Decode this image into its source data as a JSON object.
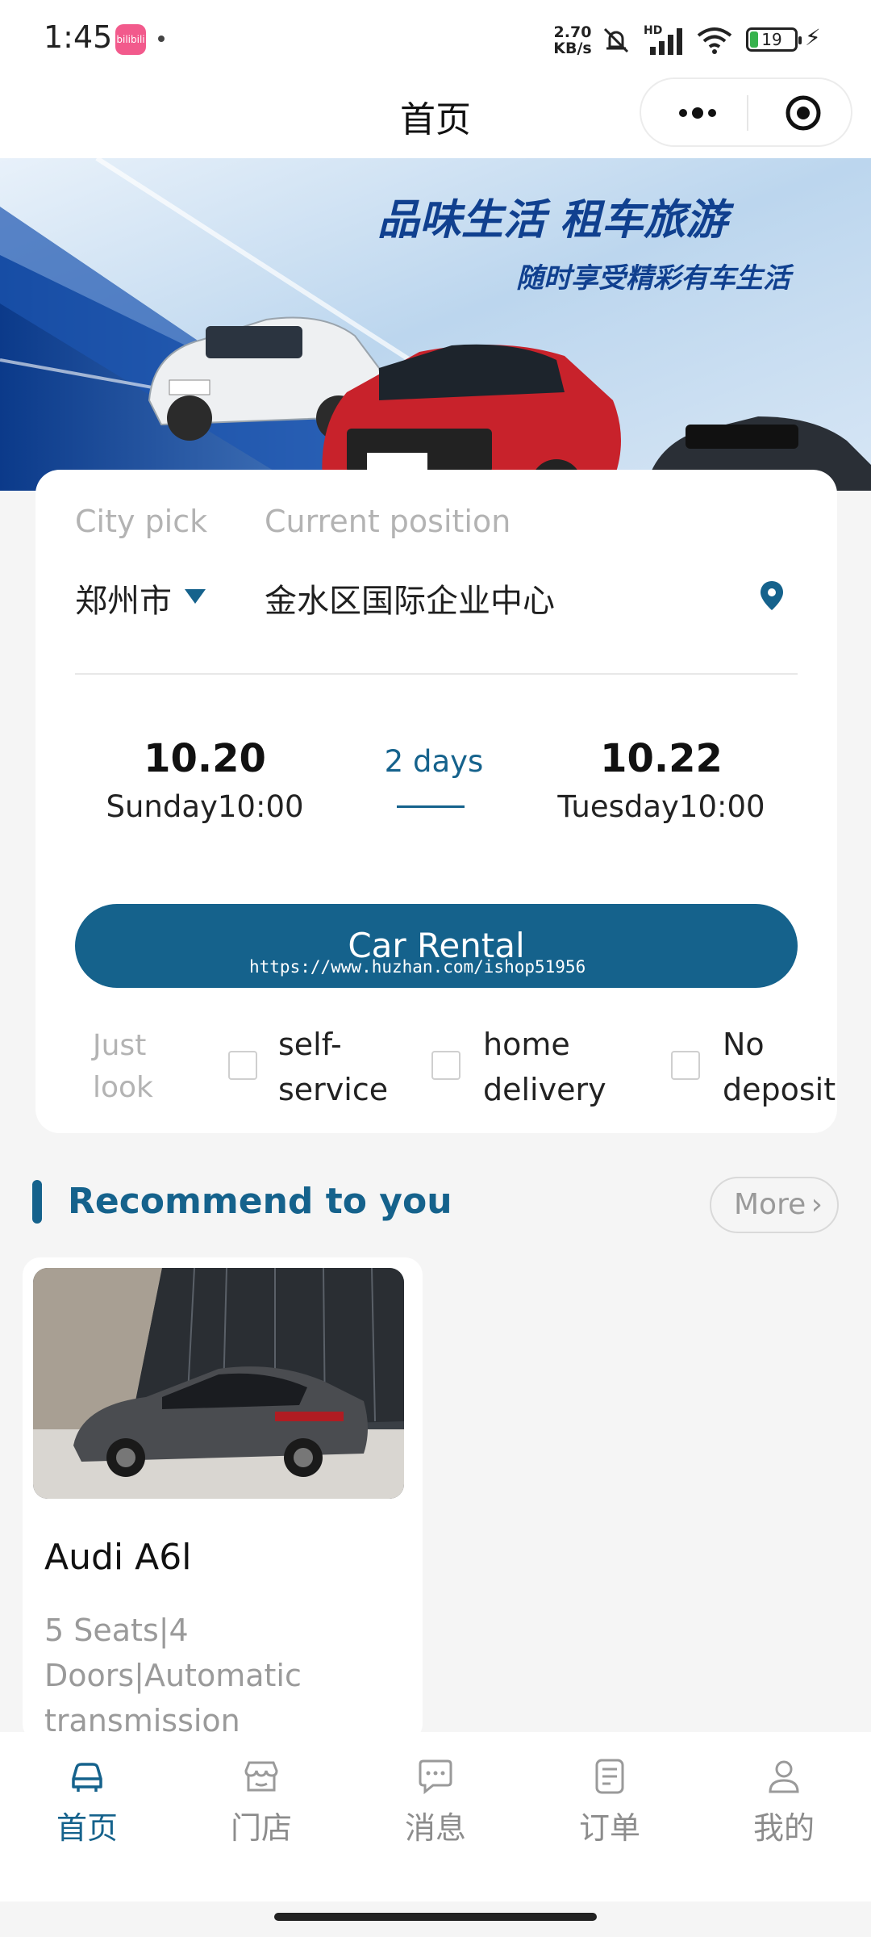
{
  "status_bar": {
    "time": "1:45",
    "app_badge": "bilibili",
    "net_speed_top": "2.70",
    "net_speed_bottom": "KB/s",
    "signal_label": "HD",
    "battery": "19"
  },
  "navbar": {
    "title": "首页"
  },
  "banner": {
    "headline": "品味生活 租车旅游",
    "tagline": "随时享受精彩有车生活"
  },
  "booking": {
    "city_label": "City pick",
    "position_label": "Current position",
    "city_value": "郑州市",
    "position_value": "金水区国际企业中心",
    "start_date": "10.20",
    "start_day_time": "Sunday10:00",
    "duration": "2 days",
    "end_date": "10.22",
    "end_day_time": "Tuesday10:00",
    "rent_button": "Car Rental",
    "watermark": "https://www.huzhan.com/ishop51956",
    "options": {
      "just_look_1": "Just",
      "just_look_2": "look",
      "self_service_1": "self-",
      "self_service_2": "service",
      "home_delivery_1": "home",
      "home_delivery_2": "delivery",
      "no_deposit_1": "No",
      "no_deposit_2": "deposit"
    }
  },
  "recommend": {
    "title": "Recommend to you",
    "more": "More",
    "cars": [
      {
        "name": "Audi A6l",
        "spec": "5 Seats|4 Doors|Automatic transmission"
      }
    ]
  },
  "tabbar": {
    "items": [
      {
        "label": "首页",
        "icon": "car-icon",
        "active": true
      },
      {
        "label": "门店",
        "icon": "store-icon",
        "active": false
      },
      {
        "label": "消息",
        "icon": "message-icon",
        "active": false
      },
      {
        "label": "订单",
        "icon": "order-icon",
        "active": false
      },
      {
        "label": "我的",
        "icon": "user-icon",
        "active": false
      }
    ]
  },
  "colors": {
    "accent": "#15628c",
    "muted": "#b3b3b3",
    "background": "#f5f5f5"
  }
}
